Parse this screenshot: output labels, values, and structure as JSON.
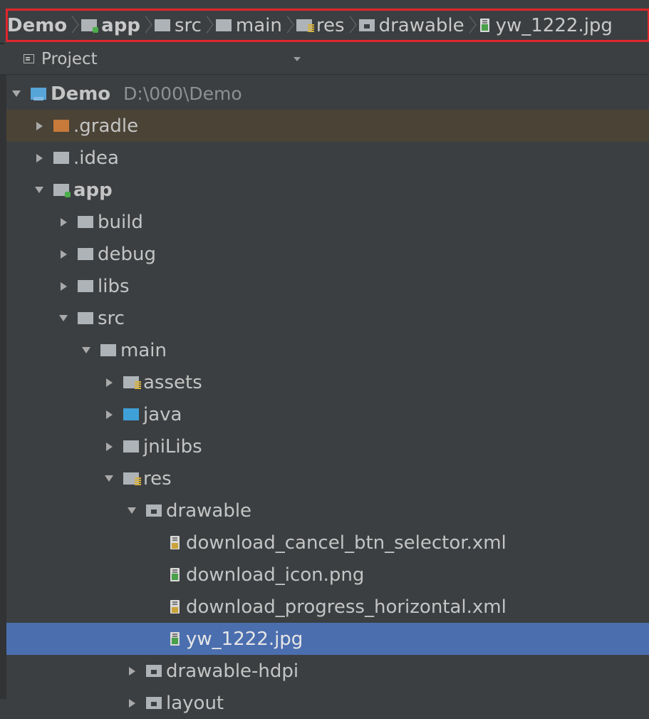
{
  "breadcrumb": {
    "items": [
      {
        "label": "Demo",
        "icon": "none",
        "bold": true
      },
      {
        "label": "app",
        "icon": "module-folder-icon",
        "bold": true
      },
      {
        "label": "src",
        "icon": "folder-icon",
        "bold": false
      },
      {
        "label": "main",
        "icon": "folder-icon",
        "bold": false
      },
      {
        "label": "res",
        "icon": "resource-folder-icon",
        "bold": false
      },
      {
        "label": "drawable",
        "icon": "package-folder-icon",
        "bold": false
      },
      {
        "label": "yw_1222.jpg",
        "icon": "image-file-icon",
        "bold": false
      }
    ],
    "highlight_color": "#e0262c"
  },
  "panel": {
    "title": "Project",
    "icon": "project-view-icon"
  },
  "tree": [
    {
      "label": "Demo",
      "path": "D:\\000\\Demo",
      "depth": 0,
      "state": "expanded",
      "icon": "demo-project-folder-icon",
      "bold": true
    },
    {
      "label": ".gradle",
      "depth": 1,
      "state": "collapsed",
      "icon": "gradle-folder-icon",
      "highlight": "brown"
    },
    {
      "label": ".idea",
      "depth": 1,
      "state": "collapsed",
      "icon": "folder-icon"
    },
    {
      "label": "app",
      "depth": 1,
      "state": "expanded",
      "icon": "module-folder-icon",
      "bold": true
    },
    {
      "label": "build",
      "depth": 2,
      "state": "collapsed",
      "icon": "folder-icon"
    },
    {
      "label": "debug",
      "depth": 2,
      "state": "collapsed",
      "icon": "folder-icon"
    },
    {
      "label": "libs",
      "depth": 2,
      "state": "collapsed",
      "icon": "folder-icon"
    },
    {
      "label": "src",
      "depth": 2,
      "state": "expanded",
      "icon": "folder-icon"
    },
    {
      "label": "main",
      "depth": 3,
      "state": "expanded",
      "icon": "folder-icon"
    },
    {
      "label": "assets",
      "depth": 4,
      "state": "collapsed",
      "icon": "resource-folder-icon"
    },
    {
      "label": "java",
      "depth": 4,
      "state": "collapsed",
      "icon": "source-folder-icon"
    },
    {
      "label": "jniLibs",
      "depth": 4,
      "state": "collapsed",
      "icon": "folder-icon"
    },
    {
      "label": "res",
      "depth": 4,
      "state": "expanded",
      "icon": "resource-folder-icon"
    },
    {
      "label": "drawable",
      "depth": 5,
      "state": "expanded",
      "icon": "package-folder-icon"
    },
    {
      "label": "download_cancel_btn_selector.xml",
      "depth": 6,
      "state": "leaf",
      "icon": "xml-file-icon"
    },
    {
      "label": "download_icon.png",
      "depth": 6,
      "state": "leaf",
      "icon": "image-file-icon"
    },
    {
      "label": "download_progress_horizontal.xml",
      "depth": 6,
      "state": "leaf",
      "icon": "xml-file-icon"
    },
    {
      "label": "yw_1222.jpg",
      "depth": 6,
      "state": "leaf",
      "icon": "image-file-icon",
      "selected": true
    },
    {
      "label": "drawable-hdpi",
      "depth": 5,
      "state": "collapsed",
      "icon": "package-folder-icon"
    },
    {
      "label": "layout",
      "depth": 5,
      "state": "collapsed",
      "icon": "package-folder-icon"
    }
  ],
  "colors": {
    "background": "#3c3f41",
    "selection": "#4b6eaf",
    "gradle_row": "#4a4336"
  }
}
